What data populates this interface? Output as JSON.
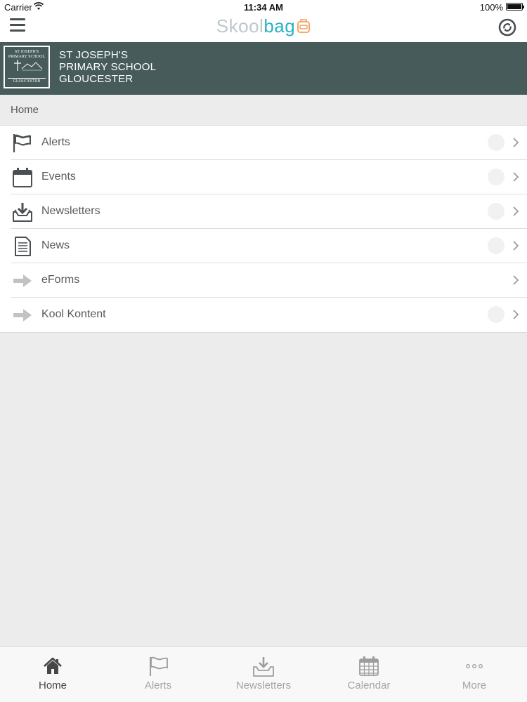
{
  "status_bar": {
    "carrier": "Carrier",
    "time": "11:34 AM",
    "battery": "100%"
  },
  "nav": {
    "logo_part1": "Skool",
    "logo_part2": "bag",
    "menu_icon": "hamburger-icon",
    "sync_icon": "sync-icon"
  },
  "school": {
    "crest_top": "ST JOSEPH'S PRIMARY SCHOOL",
    "crest_bottom": "GLOUCESTER",
    "name_line1": "ST JOSEPH'S",
    "name_line2": "PRIMARY SCHOOL",
    "name_line3": "GLOUCESTER",
    "banner_color": "#475b5b"
  },
  "breadcrumb": "Home",
  "menu": {
    "items": [
      {
        "label": "Alerts",
        "icon": "flag-icon"
      },
      {
        "label": "Events",
        "icon": "calendar-icon"
      },
      {
        "label": "Newsletters",
        "icon": "inbox-download-icon"
      },
      {
        "label": "News",
        "icon": "document-icon"
      },
      {
        "label": "eForms",
        "icon": "arrow-right-icon"
      },
      {
        "label": "Kool Kontent",
        "icon": "arrow-right-icon"
      }
    ]
  },
  "tabs": {
    "items": [
      {
        "label": "Home",
        "icon": "home-icon",
        "active": true
      },
      {
        "label": "Alerts",
        "icon": "flag-icon"
      },
      {
        "label": "Newsletters",
        "icon": "inbox-download-icon"
      },
      {
        "label": "Calendar",
        "icon": "calendar-icon"
      },
      {
        "label": "More",
        "icon": "more-dots-icon"
      }
    ]
  },
  "colors": {
    "accent": "#27b3c6",
    "banner": "#475b5b",
    "icon": "#4a4f52"
  }
}
